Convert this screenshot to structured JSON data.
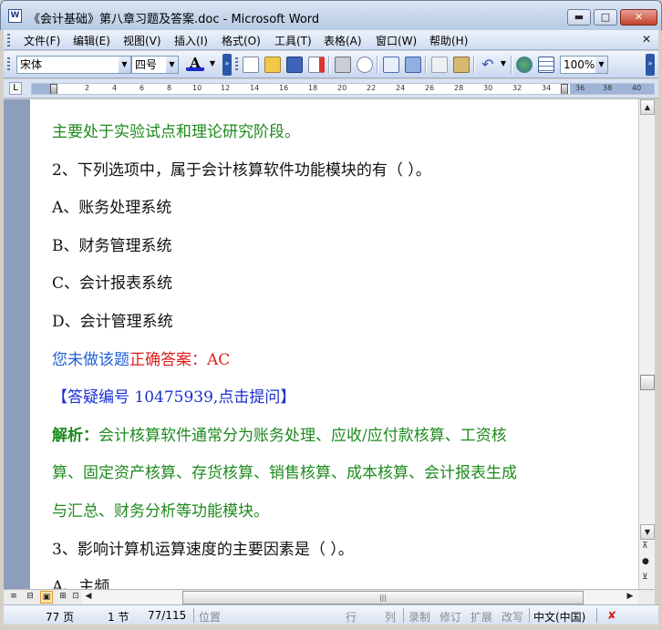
{
  "window": {
    "title": "《会计基础》第八章习题及答案.doc - Microsoft Word",
    "app_icon": "W",
    "min_glyph": "▬",
    "max_glyph": "□",
    "close_glyph": "✕"
  },
  "menu": {
    "items": [
      "文件(F)",
      "编辑(E)",
      "视图(V)",
      "插入(I)",
      "格式(O)",
      "工具(T)",
      "表格(A)",
      "窗口(W)",
      "帮助(H)"
    ],
    "close_glyph": "✕"
  },
  "toolbar": {
    "font_name": "宋体",
    "font_size": "四号",
    "font_color_label": "A",
    "zoom": "100%",
    "icons": [
      "new-document-icon",
      "open-folder-icon",
      "save-icon",
      "permission-icon",
      "print-icon",
      "print-preview-icon",
      "spelling-icon",
      "research-icon",
      "copy-icon",
      "paste-icon",
      "undo-icon",
      "hyperlink-icon",
      "table-icon"
    ]
  },
  "ruler": {
    "tab_glyph": "L",
    "numbers": [
      "2",
      "4",
      "6",
      "8",
      "10",
      "12",
      "14",
      "16",
      "18",
      "20",
      "22",
      "24",
      "26",
      "28",
      "30",
      "32",
      "34",
      "36",
      "38",
      "40"
    ]
  },
  "document": {
    "lines": [
      {
        "text": "主要处于实验试点和理论研究阶段。"
      },
      {
        "text": "2、下列选项中，属于会计核算软件功能模块的有（ ）。"
      },
      {
        "text": "A、账务处理系统"
      },
      {
        "text": "B、财务管理系统"
      },
      {
        "text": "C、会计报表系统"
      },
      {
        "text": "D、会计管理系统"
      },
      {
        "part1": "您未做该题",
        "part2": "正确答案：AC"
      },
      {
        "text": "【答疑编号 10475939,点击提问】"
      },
      {
        "label": "解析：",
        "text": "会计核算软件通常分为账务处理、应收/应付款核算、工资核"
      },
      {
        "text": "算、固定资产核算、存货核算、销售核算、成本核算、会计报表生成"
      },
      {
        "text": "与汇总、财务分析等功能模块。"
      },
      {
        "text": "3、影响计算机运算速度的主要因素是（ ）。"
      },
      {
        "text": "A、主频"
      }
    ]
  },
  "scrollbar": {
    "up": "▲",
    "down": "▼",
    "prev_page": "⊼",
    "select_browse": "●",
    "next_page": "⊻",
    "left": "◀",
    "right": "▶",
    "thumb_grip": "|||"
  },
  "views": [
    "≡",
    "⊟",
    "▣",
    "⊞",
    "⊡"
  ],
  "status": {
    "page": "77 页",
    "section": "1 节",
    "page_of": "77/115",
    "position": "位置",
    "line": "行",
    "column": "列",
    "rec": "录制",
    "trk": "修订",
    "ext": "扩展",
    "ovr": "改写",
    "language": "中文(中国)",
    "spell_icon": "✘"
  }
}
